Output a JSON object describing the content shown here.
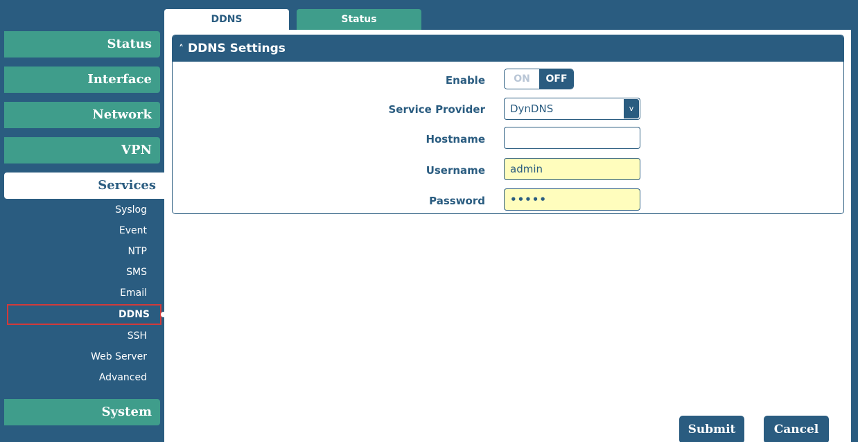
{
  "tabs": [
    {
      "label": "DDNS",
      "active": true
    },
    {
      "label": "Status",
      "active": false
    }
  ],
  "sidebar": {
    "main_items": [
      {
        "label": "Status"
      },
      {
        "label": "Interface"
      },
      {
        "label": "Network"
      },
      {
        "label": "VPN"
      },
      {
        "label": "Services"
      },
      {
        "label": "System"
      }
    ],
    "services_items": [
      {
        "label": "Syslog"
      },
      {
        "label": "Event"
      },
      {
        "label": "NTP"
      },
      {
        "label": "SMS"
      },
      {
        "label": "Email"
      },
      {
        "label": "DDNS"
      },
      {
        "label": "SSH"
      },
      {
        "label": "Web Server"
      },
      {
        "label": "Advanced"
      }
    ]
  },
  "panel": {
    "title": "DDNS Settings",
    "enable": {
      "label": "Enable",
      "on_label": "ON",
      "off_label": "OFF",
      "value": "OFF"
    },
    "service_provider": {
      "label": "Service Provider",
      "value": "DynDNS"
    },
    "hostname": {
      "label": "Hostname",
      "value": ""
    },
    "username": {
      "label": "Username",
      "value": "admin"
    },
    "password": {
      "label": "Password",
      "masked_value": "•••••"
    }
  },
  "buttons": {
    "submit": "Submit",
    "cancel": "Cancel"
  },
  "colors": {
    "primary": "#2a5c80",
    "accent": "#3f9d8b",
    "filled_input": "#fffdbd",
    "highlight": "#d23a3a"
  }
}
